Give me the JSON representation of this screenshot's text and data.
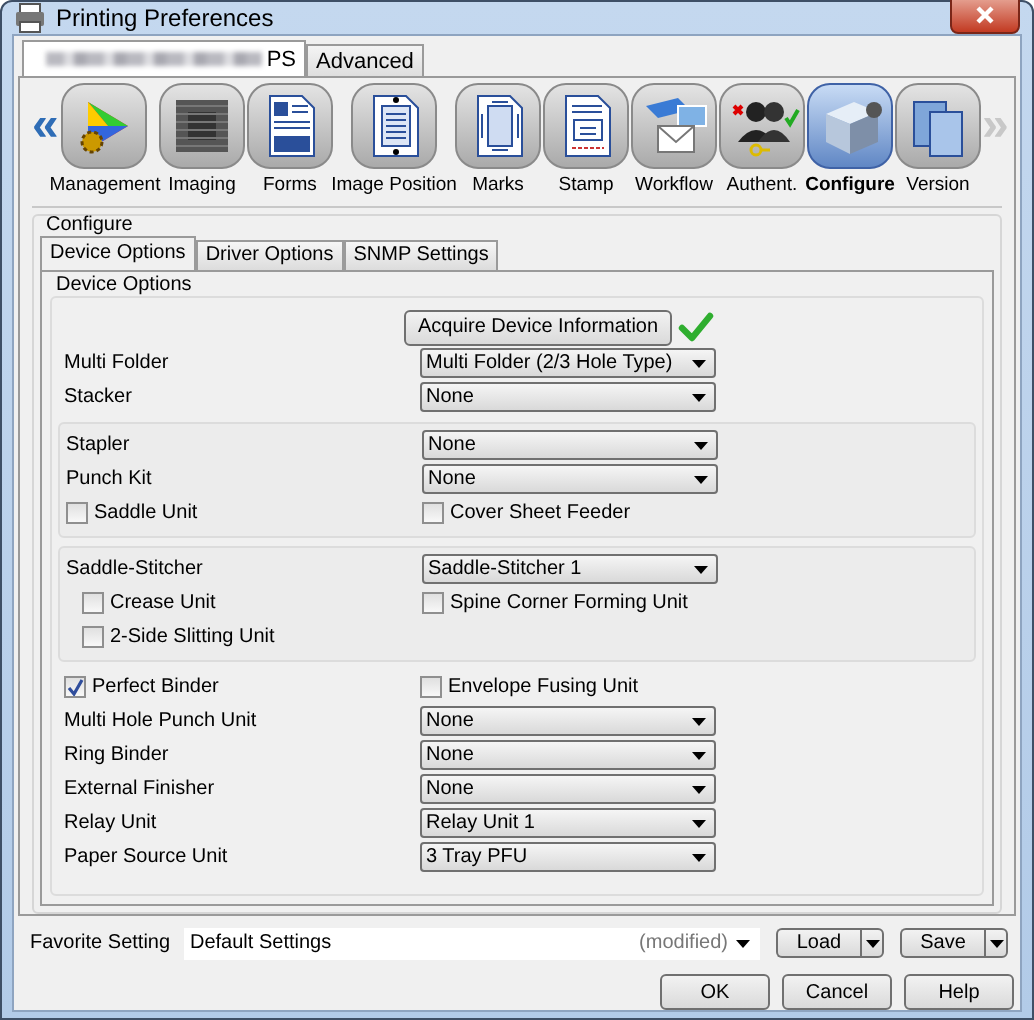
{
  "window": {
    "title": "Printing Preferences"
  },
  "tabs": [
    {
      "label": "PS",
      "selected": true,
      "blurred": true
    },
    {
      "label": "Advanced",
      "selected": false,
      "blurred": false
    }
  ],
  "categories": {
    "scroll_left": {
      "label": "«",
      "disabled": false
    },
    "scroll_right": {
      "label": "»",
      "disabled": true
    },
    "items": [
      {
        "label": "Management",
        "selected": false
      },
      {
        "label": "Imaging",
        "selected": false
      },
      {
        "label": "Forms",
        "selected": false
      },
      {
        "label": "Image Position",
        "selected": false
      },
      {
        "label": "Marks",
        "selected": false
      },
      {
        "label": "Stamp",
        "selected": false
      },
      {
        "label": "Workflow",
        "selected": false
      },
      {
        "label": "Authent.",
        "selected": false
      },
      {
        "label": "Configure",
        "selected": true
      },
      {
        "label": "Version",
        "selected": false
      }
    ]
  },
  "group_title": "Configure",
  "subtabs": [
    {
      "label": "Device Options",
      "selected": true
    },
    {
      "label": "Driver Options",
      "selected": false
    },
    {
      "label": "SNMP Settings",
      "selected": false
    }
  ],
  "device_options": {
    "title": "Device Options",
    "acquire_button": "Acquire Device Information",
    "acquired": true,
    "sections": [
      {
        "framed": false,
        "rows": [
          {
            "kind": "dropdown",
            "label": "Multi Folder",
            "value": "Multi Folder (2/3 Hole Type)"
          },
          {
            "kind": "dropdown",
            "label": "Stacker",
            "value": "None"
          }
        ]
      },
      {
        "framed": true,
        "rows": [
          {
            "kind": "dropdown",
            "label": "Stapler",
            "value": "None"
          },
          {
            "kind": "dropdown",
            "label": "Punch Kit",
            "value": "None"
          },
          {
            "kind": "checkboxes",
            "items": [
              {
                "label": "Saddle Unit",
                "checked": false
              },
              {
                "label": "Cover Sheet Feeder",
                "checked": false
              }
            ]
          }
        ]
      },
      {
        "framed": true,
        "rows": [
          {
            "kind": "dropdown",
            "label": "Saddle-Stitcher",
            "value": "Saddle-Stitcher 1",
            "children": [
              {
                "kind": "checkboxes",
                "items": [
                  {
                    "label": "Crease Unit",
                    "checked": false
                  },
                  {
                    "label": "Spine Corner Forming Unit",
                    "checked": false
                  }
                ]
              },
              {
                "kind": "checkboxes",
                "items": [
                  {
                    "label": "2-Side Slitting Unit",
                    "checked": false
                  }
                ]
              }
            ]
          }
        ]
      },
      {
        "framed": false,
        "rows": [
          {
            "kind": "checkboxes",
            "items": [
              {
                "label": "Perfect Binder",
                "checked": true
              },
              {
                "label": "Envelope Fusing Unit",
                "checked": false
              }
            ]
          },
          {
            "kind": "dropdown",
            "label": "Multi Hole Punch Unit",
            "value": "None"
          },
          {
            "kind": "dropdown",
            "label": "Ring Binder",
            "value": "None"
          },
          {
            "kind": "dropdown",
            "label": "External Finisher",
            "value": "None"
          },
          {
            "kind": "dropdown",
            "label": "Relay Unit",
            "value": "Relay Unit 1"
          },
          {
            "kind": "dropdown",
            "label": "Paper Source Unit",
            "value": "3 Tray PFU"
          }
        ]
      }
    ]
  },
  "favorite": {
    "label": "Favorite Setting",
    "value": "Default Settings",
    "note": "(modified)",
    "load": "Load",
    "save": "Save"
  },
  "buttons": [
    "OK",
    "Cancel",
    "Help"
  ]
}
